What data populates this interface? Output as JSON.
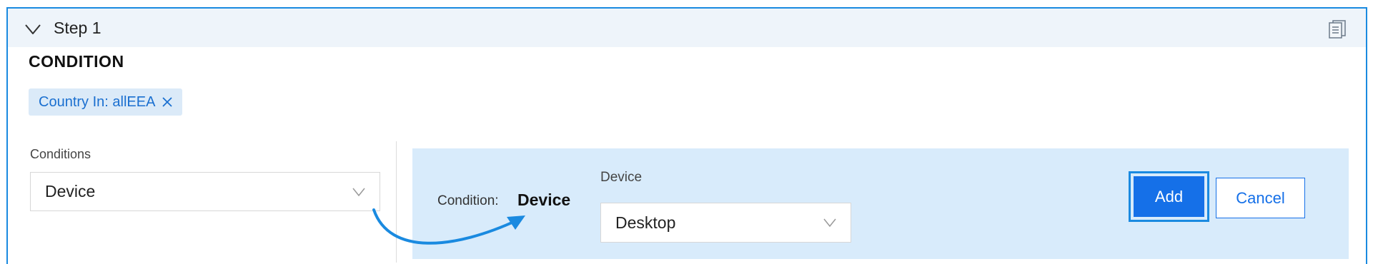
{
  "step": {
    "title": "Step 1",
    "icons": {
      "collapse": "chevron-down-icon",
      "document": "document-icon"
    }
  },
  "condition_section": {
    "heading": "CONDITION",
    "tag": {
      "label": "Country In: allEEA",
      "remove_icon": "close-icon"
    }
  },
  "conditions_picker": {
    "label": "Conditions",
    "selected": "Device"
  },
  "condition_editor": {
    "condition_label": "Condition:",
    "condition_value": "Device",
    "device_label": "Device",
    "device_selected": "Desktop"
  },
  "actions": {
    "add": "Add",
    "cancel": "Cancel"
  },
  "colors": {
    "accent": "#1570e8",
    "focus_ring": "#1a8ae0",
    "panel_bg": "#d8ebfb",
    "tag_bg": "#dbeaf8",
    "header_bg": "#eef4fa"
  }
}
